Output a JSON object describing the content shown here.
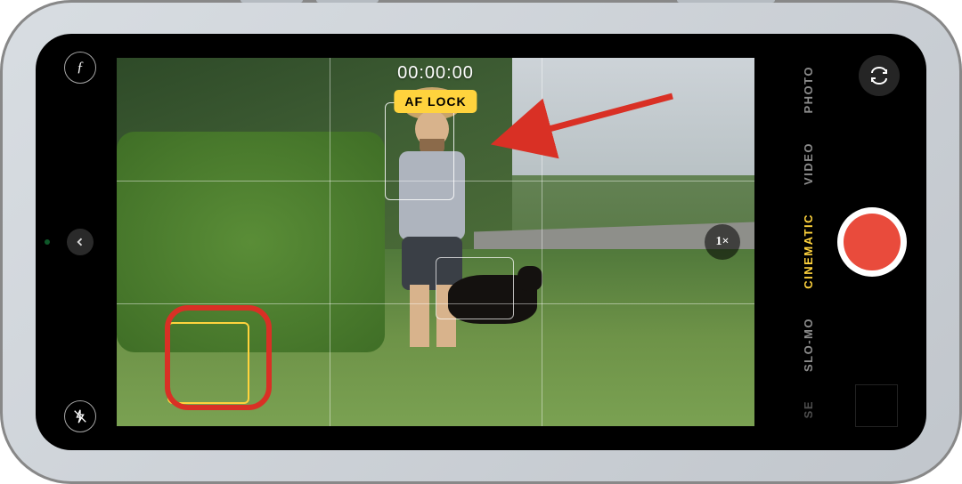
{
  "timer": "00:00:00",
  "af_lock_label": "AF LOCK",
  "zoom_label": "1×",
  "modes": {
    "photo": "PHOTO",
    "video": "VIDEO",
    "cinematic": "CINEMATIC",
    "slomo": "SLO-MO",
    "tlapse_hint": "SE"
  },
  "active_mode": "cinematic",
  "depth_toggle_glyph": "ƒ",
  "annotations": {
    "arrow_color": "#d93025",
    "circle_color": "#d93025"
  }
}
